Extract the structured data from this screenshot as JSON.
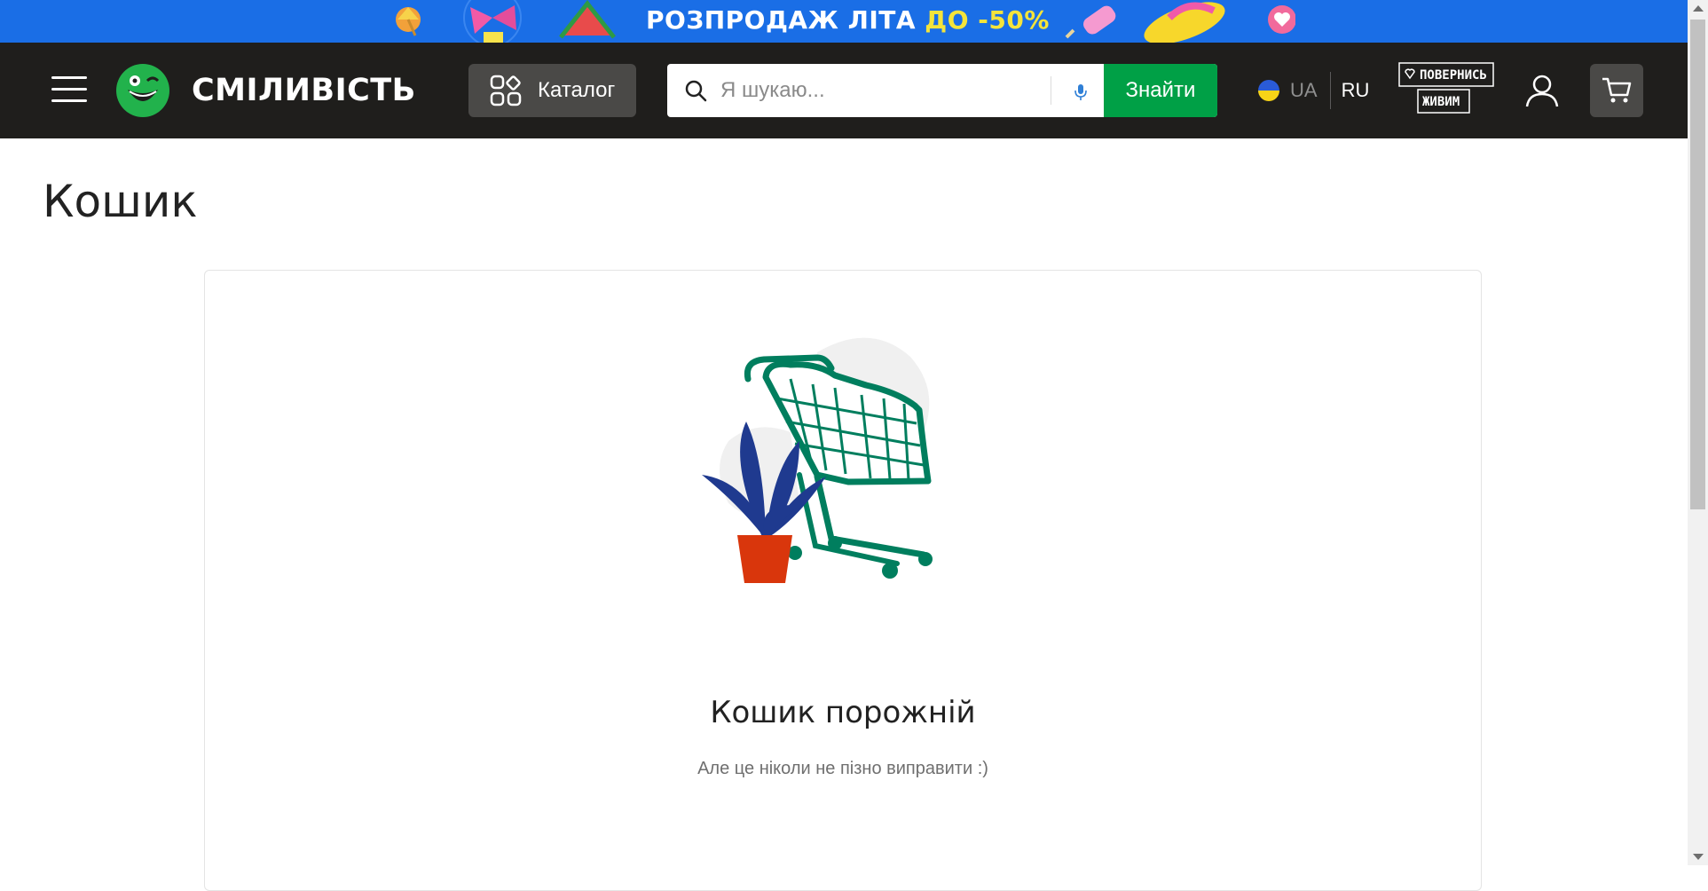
{
  "promo": {
    "text_main": "РОЗПРОДАЖ ЛІТА ",
    "text_accent": "ДО -50%"
  },
  "header": {
    "logo_text": "СМІЛИВІСТЬ",
    "catalog_label": "Каталог",
    "search": {
      "placeholder": "Я шукаю...",
      "value": ""
    },
    "find_button": "Знайти",
    "lang": {
      "ua": "UA",
      "ru": "RU"
    },
    "campaign_logo_text": [
      "ПОВЕРНИСЬ",
      "ЖИВИМ"
    ]
  },
  "page": {
    "title": "Кошик",
    "empty_title": "Кошик порожній",
    "empty_subtitle": "Але це ніколи не пізно виправити :)"
  },
  "colors": {
    "banner": "#1a6ee6",
    "banner_accent": "#f4e43b",
    "header_bg": "#1f1e1c",
    "button_dark": "#4a4947",
    "find_button": "#00a046",
    "cart_illustration": "#007e5e",
    "plant": "#1f3a8f",
    "pot": "#d9360c"
  },
  "icons": [
    "menu-icon",
    "logo-mark-icon",
    "catalog-icon",
    "search-icon",
    "microphone-icon",
    "ukraine-flag-icon",
    "user-icon",
    "cart-icon"
  ]
}
